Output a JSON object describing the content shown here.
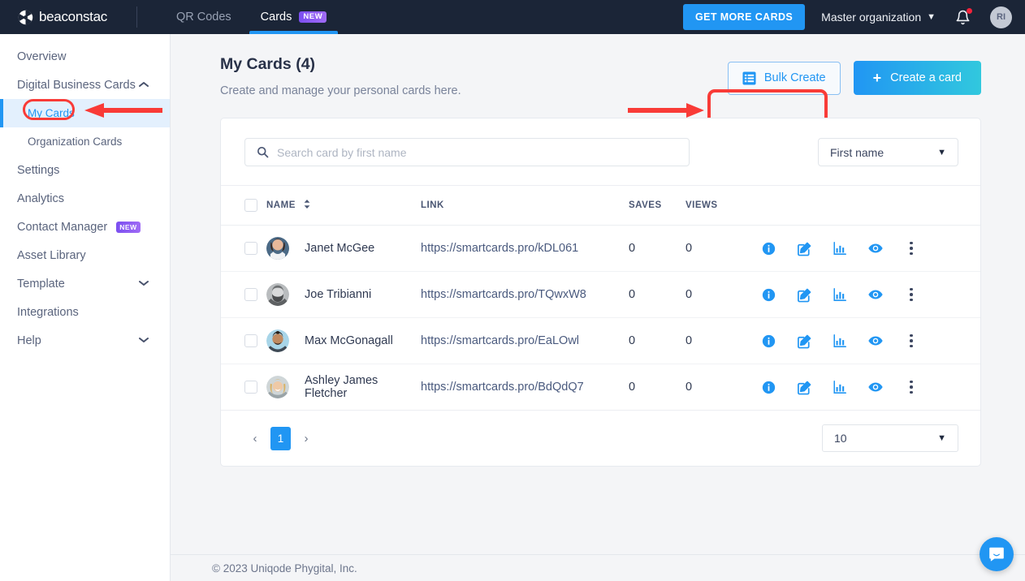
{
  "header": {
    "brand": "beaconstac",
    "nav": [
      {
        "label": "QR Codes",
        "active": false,
        "badge": null
      },
      {
        "label": "Cards",
        "active": true,
        "badge": "NEW"
      }
    ],
    "get_more_cards": "GET MORE CARDS",
    "organization": "Master organization",
    "avatar_initials": "RI",
    "icons": {
      "bell": "bell-icon",
      "chevron": "chevron-down-icon"
    }
  },
  "sidebar": {
    "items": [
      {
        "label": "Overview",
        "type": "link"
      },
      {
        "label": "Digital Business Cards",
        "type": "group",
        "caret": "chevron-up-icon"
      },
      {
        "label": "My Cards",
        "type": "sub",
        "active": true
      },
      {
        "label": "Organization Cards",
        "type": "sub",
        "active": false
      },
      {
        "label": "Settings",
        "type": "link"
      },
      {
        "label": "Analytics",
        "type": "link"
      },
      {
        "label": "Contact Manager",
        "type": "link",
        "badge": "NEW"
      },
      {
        "label": "Asset Library",
        "type": "link"
      },
      {
        "label": "Template",
        "type": "group",
        "caret": "chevron-down-icon"
      },
      {
        "label": "Integrations",
        "type": "link"
      },
      {
        "label": "Help",
        "type": "group",
        "caret": "chevron-down-icon"
      }
    ]
  },
  "main": {
    "title": "My Cards (4)",
    "subtitle": "Create and manage your personal cards here.",
    "bulk_create_label": "Bulk Create",
    "create_card_label": "Create a card"
  },
  "search": {
    "placeholder": "Search card by first name",
    "value": "",
    "filter_value": "First name"
  },
  "table": {
    "columns": [
      "NAME",
      "LINK",
      "SAVES",
      "VIEWS"
    ],
    "rows": [
      {
        "name": "Janet McGee",
        "link": "https://smartcards.pro/kDL061",
        "saves": "0",
        "views": "0"
      },
      {
        "name": "Joe Tribianni",
        "link": "https://smartcards.pro/TQwxW8",
        "saves": "0",
        "views": "0"
      },
      {
        "name": "Max McGonagall",
        "link": "https://smartcards.pro/EaLOwl",
        "saves": "0",
        "views": "0"
      },
      {
        "name": "Ashley James Fletcher",
        "link": "https://smartcards.pro/BdQdQ7",
        "saves": "0",
        "views": "0"
      }
    ],
    "row_actions": [
      "info-icon",
      "edit-icon",
      "analytics-icon",
      "preview-eye-icon",
      "more-options-icon"
    ]
  },
  "pagination": {
    "prev": "‹",
    "page": "1",
    "next": "›",
    "per_page": "10"
  },
  "footer": {
    "copyright": "© 2023 Uniqode Phygital, Inc."
  },
  "chat": {
    "icon": "chat-bubble-icon"
  },
  "annotations": {
    "color": "#f93b37",
    "items": [
      "arrow-pointing-to-my-cards",
      "circle-around-my-cards",
      "arrow-pointing-to-bulk-create",
      "rectangle-around-bulk-create"
    ]
  },
  "colors": {
    "topbar_bg": "#1b2537",
    "accent_blue": "#2196f3",
    "gradient_end": "#31c8de",
    "badge_purple": "#7b4ff0",
    "annotation_red": "#f93b37",
    "page_bg": "#f4f5f7"
  }
}
